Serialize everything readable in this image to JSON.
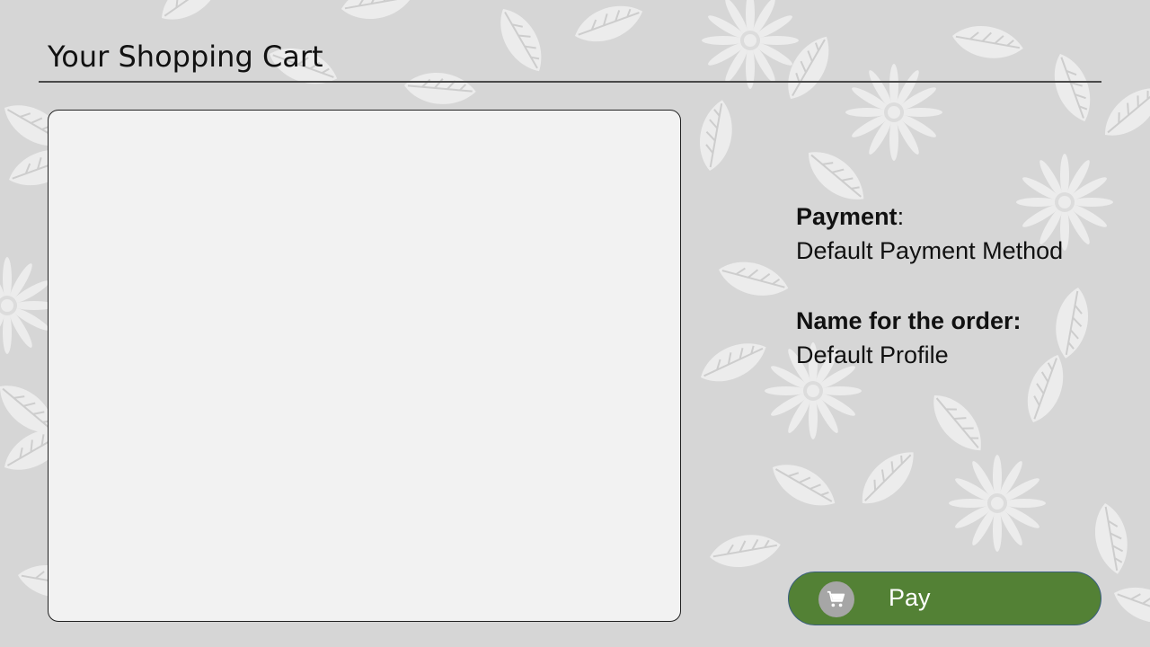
{
  "header": {
    "title": "Your Shopping Cart"
  },
  "cart": {
    "items": []
  },
  "payment": {
    "label": "Payment",
    "separator": ":",
    "value": "Default Payment Method"
  },
  "order_name": {
    "label": "Name for the order:",
    "value": "Default Profile"
  },
  "pay_button": {
    "label": "Pay",
    "icon": "shopping-cart-icon",
    "color": "#538135"
  },
  "colors": {
    "background": "#d6d6d6",
    "panel": "#f2f2f2",
    "accent": "#538135"
  }
}
